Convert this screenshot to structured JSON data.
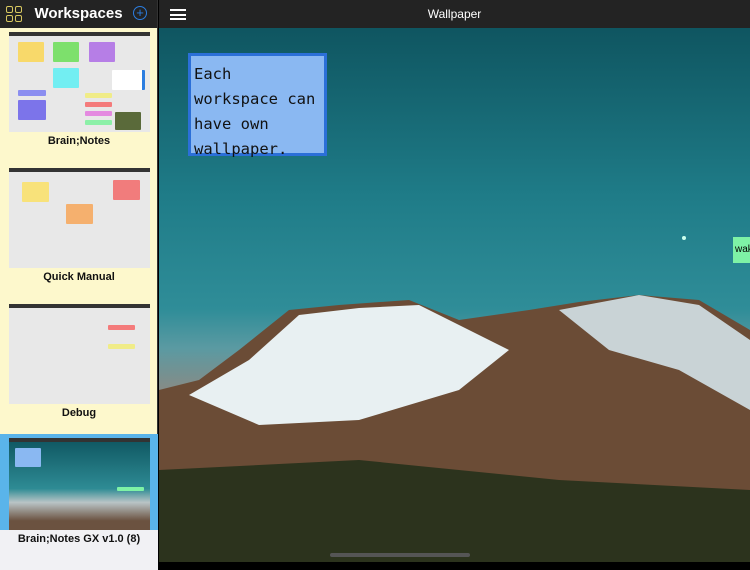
{
  "sidebar": {
    "title": "Workspaces",
    "workspaces": [
      {
        "label": "Brain;Notes"
      },
      {
        "label": "Quick Manual"
      },
      {
        "label": "Debug"
      },
      {
        "label": "Brain;Notes GX v1.0 (8)",
        "selected": true
      }
    ]
  },
  "header": {
    "title": "Wallpaper"
  },
  "note": {
    "text": "Each workspace can have own wallpaper."
  },
  "edge_note": {
    "text": "wak"
  },
  "colors": {
    "accent": "#2b7de0",
    "note_bg": "#8ab8f2",
    "note_border": "#2b6fd8",
    "sidebar_bg": "#fdf8cc",
    "selected": "#5ab4ea"
  }
}
